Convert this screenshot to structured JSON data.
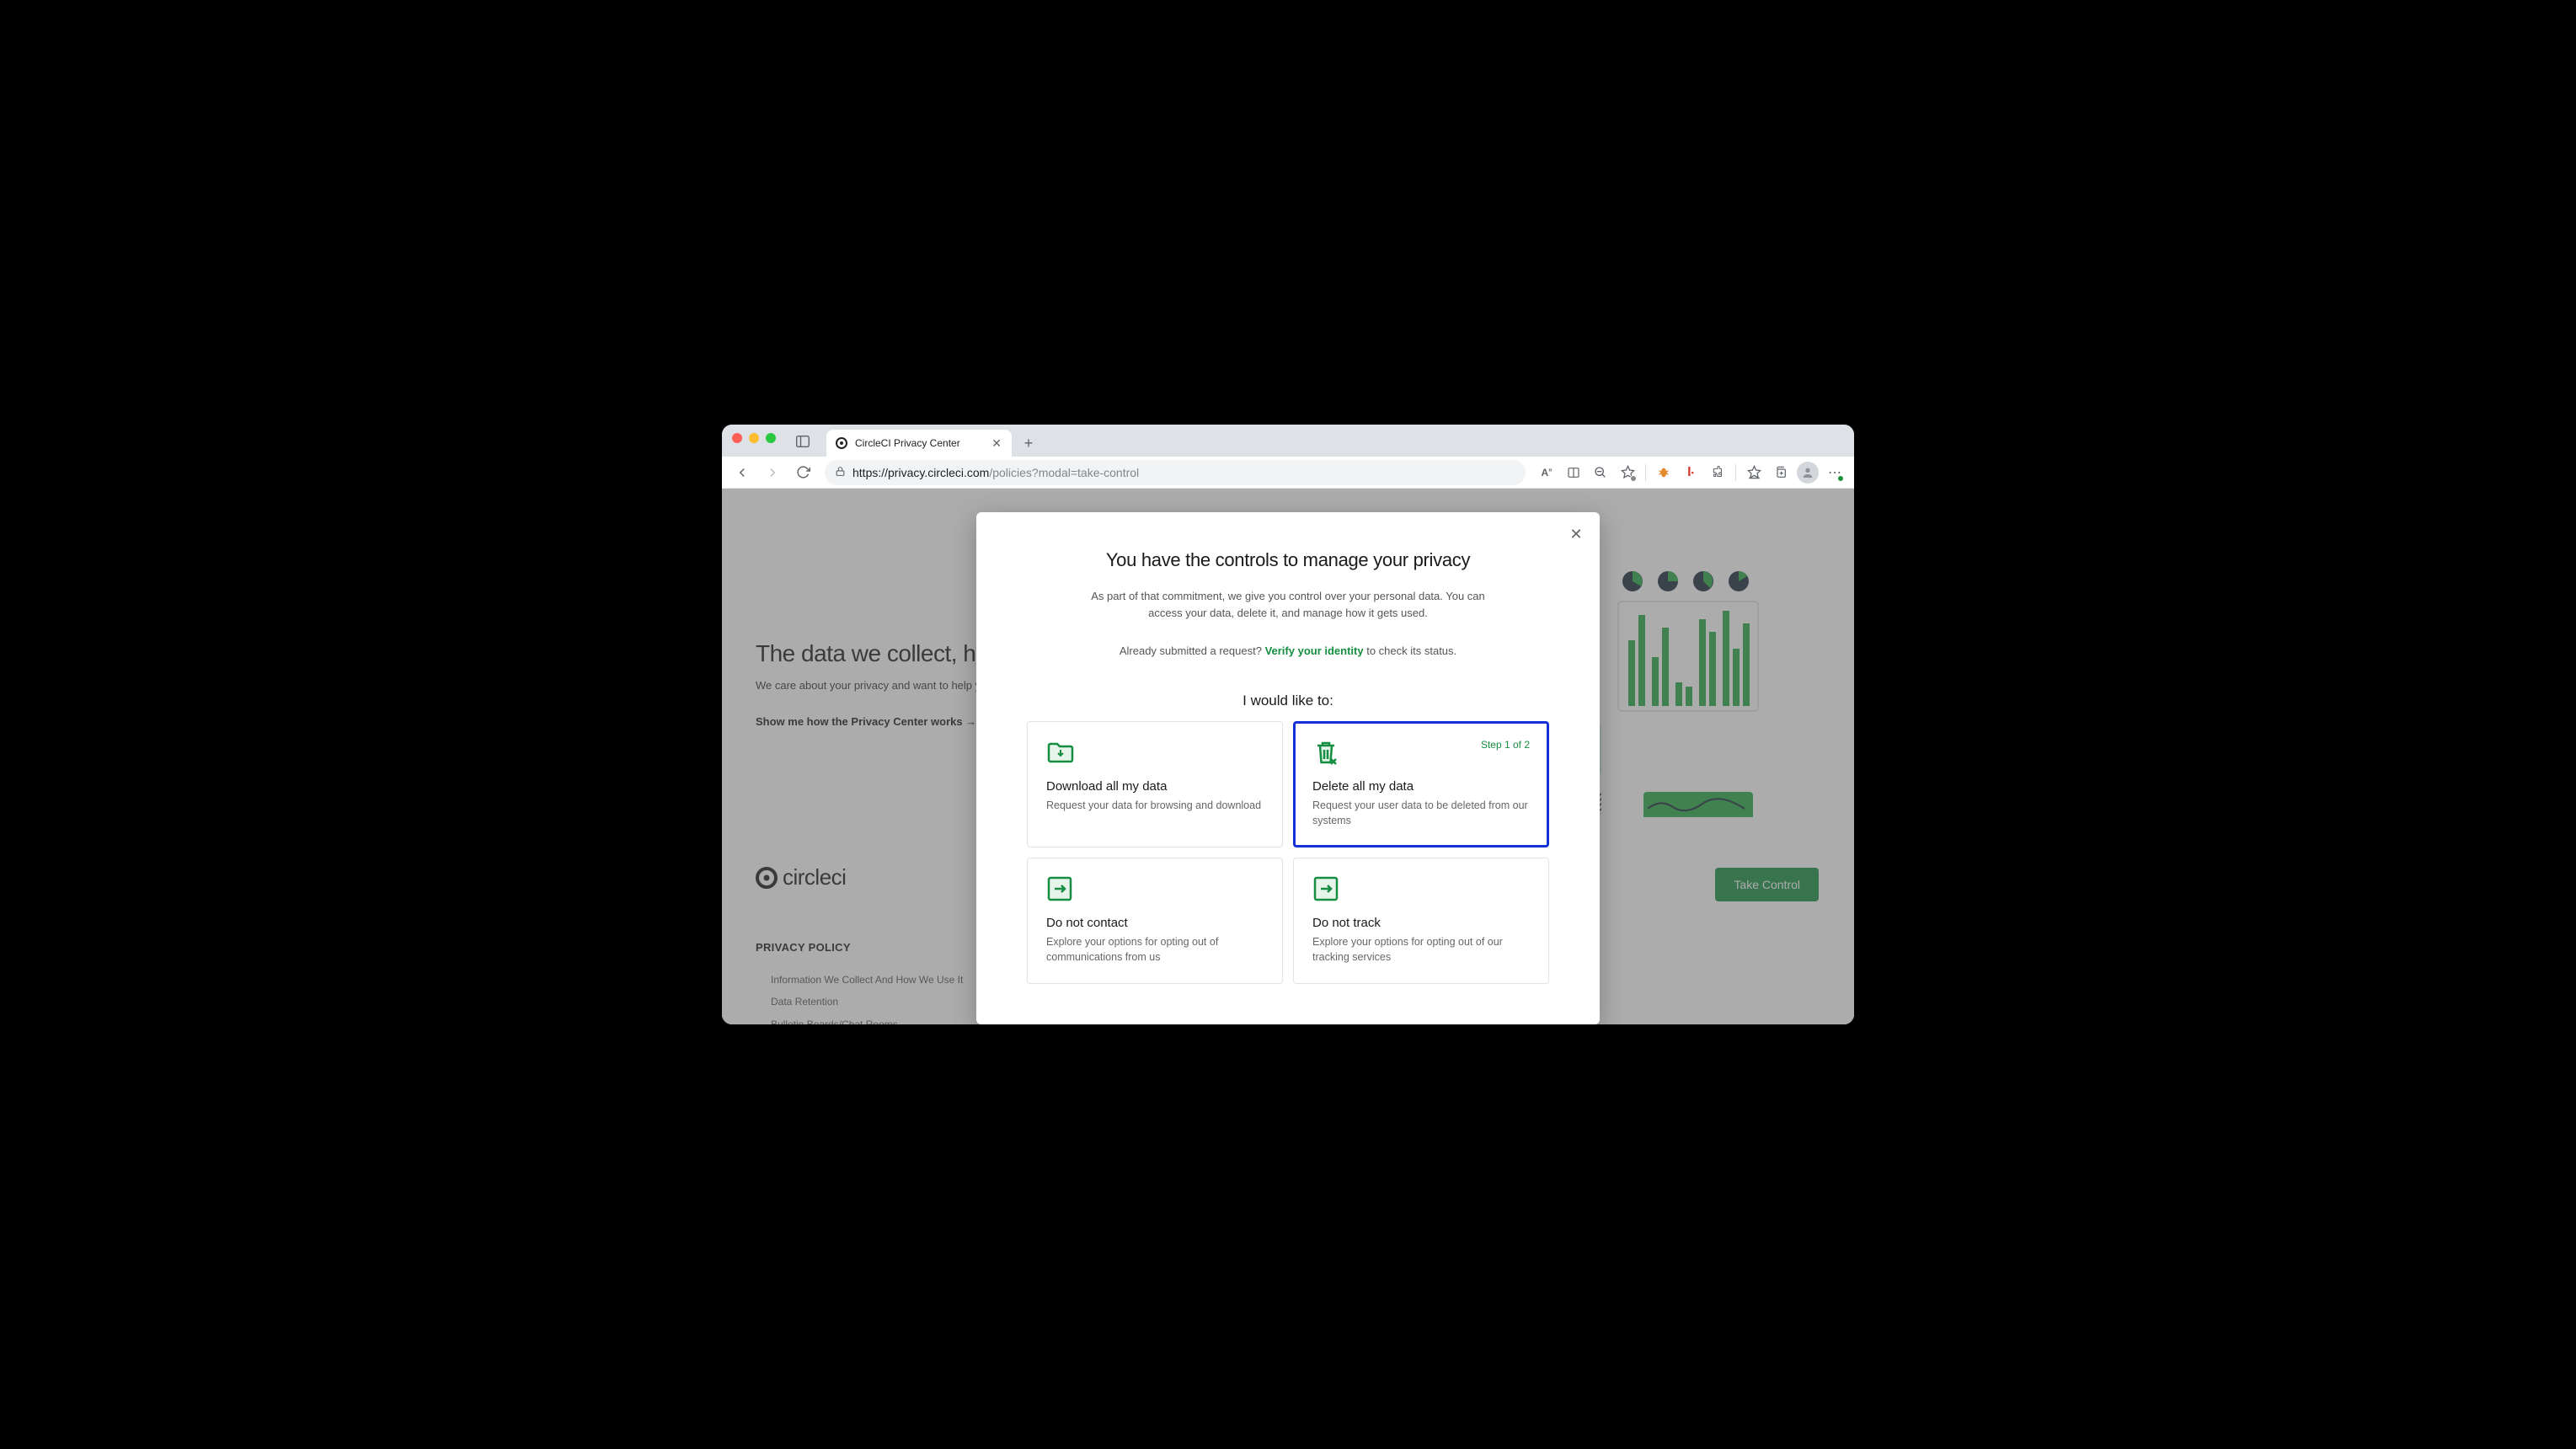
{
  "browser": {
    "tab_title": "CircleCI Privacy Center",
    "url_host": "https://privacy.circleci.com",
    "url_path": "/policies?modal=take-control"
  },
  "background": {
    "heading": "The data we collect, how it's u",
    "subheading": "We care about your privacy and want to help you under",
    "how_link": "Show me how the Privacy Center works →",
    "logo_text": "circleci",
    "policy_heading": "PRIVACY POLICY",
    "policy_items": [
      "Information We Collect And How We Use It",
      "Data Retention",
      "Bulletin Boards/Chat Rooms"
    ],
    "take_control": "Take Control"
  },
  "modal": {
    "title": "You have the controls to manage your privacy",
    "description": "As part of that commitment, we give you control over your personal data. You can access your data, delete it, and manage how it gets used.",
    "verify_prefix": "Already submitted a request? ",
    "verify_link": "Verify your identity",
    "verify_suffix": " to check its status.",
    "subheading": "I would like to:",
    "step_label": "Step 1 of 2",
    "cards": [
      {
        "title": "Download all my data",
        "desc": "Request your data for browsing and download"
      },
      {
        "title": "Delete all my data",
        "desc": "Request your user data to be deleted from our systems"
      },
      {
        "title": "Do not contact",
        "desc": "Explore your options for opting out of communications from us"
      },
      {
        "title": "Do not track",
        "desc": "Explore your options for opting out of our tracking services"
      }
    ]
  }
}
